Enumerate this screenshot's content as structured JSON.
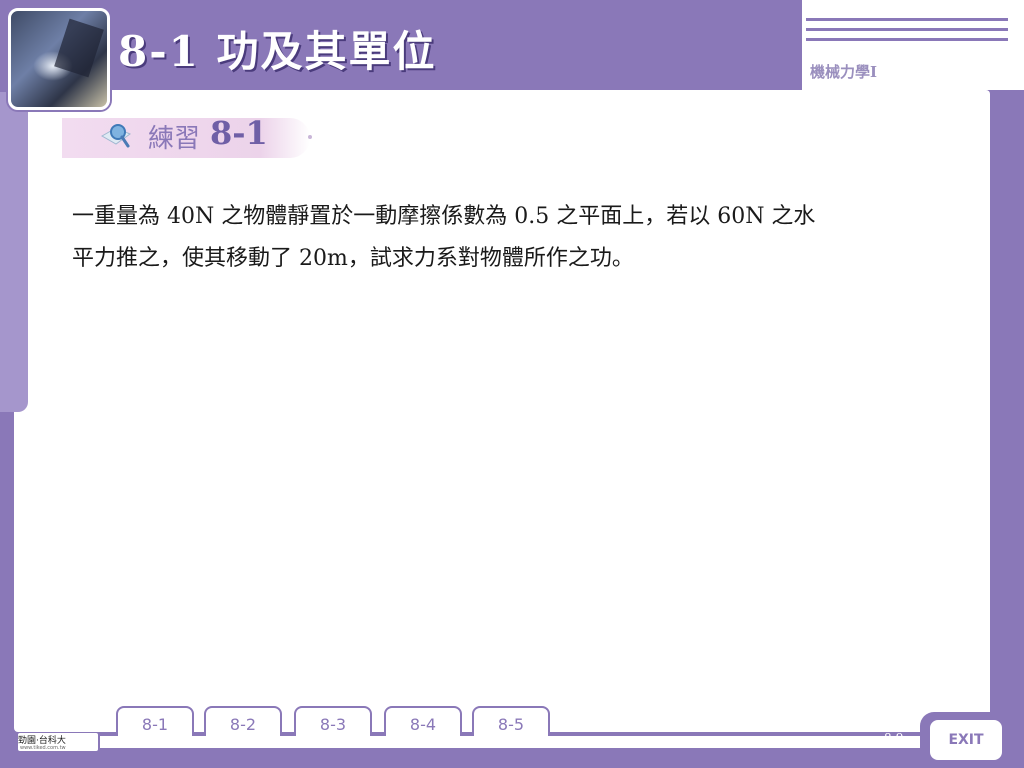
{
  "header": {
    "title": "8-1  功及其單位",
    "subject": "機械力學I"
  },
  "practice": {
    "label": "練習",
    "number": "8-1"
  },
  "problem": {
    "line1": "一重量為 40N 之物體靜置於一動摩擦係數為 0.5 之平面上，若以 60N 之水",
    "line2": "平力推之，使其移動了 20m，試求力系對物體所作之功。"
  },
  "footer": {
    "logo_text": "勁園·台科大",
    "logo_url": "www.tiked.com.tw",
    "tabs": [
      "8-1",
      "8-2",
      "8-3",
      "8-4",
      "8-5"
    ],
    "page_number": "8-9",
    "exit_label": "EXIT"
  },
  "colors": {
    "frame": "#8a78b8",
    "banner": "#f2dcf0",
    "text": "#1a1a1a"
  }
}
